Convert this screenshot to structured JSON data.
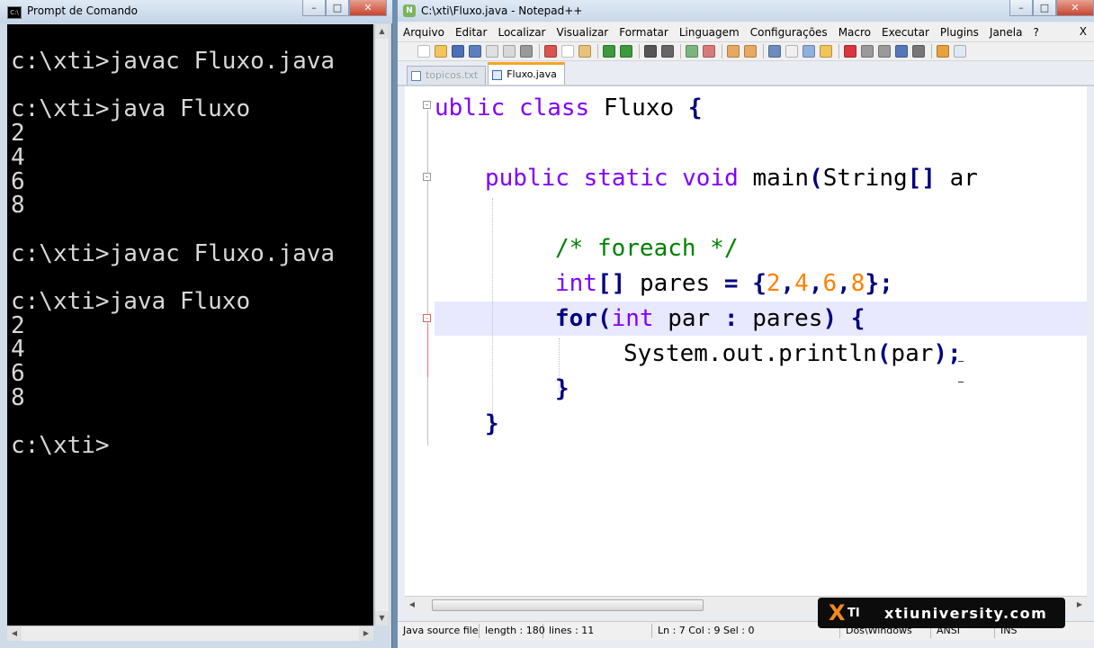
{
  "cmd": {
    "title": "Prompt de Comando",
    "output": "c:\\xti>javac Fluxo.java\n\nc:\\xti>java Fluxo\n2\n4\n6\n8\n\nc:\\xti>javac Fluxo.java\n\nc:\\xti>java Fluxo\n2\n4\n6\n8\n\nc:\\xti>"
  },
  "npp": {
    "title": "C:\\xti\\Fluxo.java - Notepad++",
    "menu": [
      "Arquivo",
      "Editar",
      "Localizar",
      "Visualizar",
      "Formatar",
      "Linguagem",
      "Configurações",
      "Macro",
      "Executar",
      "Plugins",
      "Janela",
      "?"
    ],
    "menu_close": "X",
    "tabs": [
      {
        "label": "topicos.txt",
        "active": false
      },
      {
        "label": "Fluxo.java",
        "active": true
      }
    ],
    "code": {
      "l1": {
        "kw1": "ublic",
        "kw2": "class",
        "name": "Fluxo",
        "brace": "{"
      },
      "l2": {
        "kw1": "public",
        "kw2": "static",
        "kw3": "void",
        "rest": "main",
        "p1": "(",
        "type": "String",
        "arr": "[]",
        "tail": "ar"
      },
      "l3": {
        "comment": "/* foreach */"
      },
      "l4": {
        "type": "int",
        "arr": "[]",
        "name": "pares",
        "eq": "=",
        "ob": "{",
        "n1": "2",
        "c1": ",",
        "n2": "4",
        "c2": ",",
        "n3": "6",
        "c3": ",",
        "n4": "8",
        "cb": "}",
        "semi": ";"
      },
      "l5": {
        "kw": "for",
        "p1": "(",
        "type": "int",
        "var": "par",
        "colon": ":",
        "coll": "pares",
        "p2": ")",
        "brace": "{"
      },
      "l6": {
        "call": "System.out.println",
        "p1": "(",
        "arg": "par",
        "p2": ")",
        "semi": ";"
      },
      "l7": {
        "brace": "}"
      },
      "l8": {
        "brace": "}"
      }
    },
    "status": {
      "type": "Java source file",
      "length": "length : 180",
      "lines": "lines : 11",
      "pos": "Ln : 7    Col : 9    Sel : 0",
      "eol": "Dos\\Windows",
      "enc": "ANSI",
      "mode": "INS"
    },
    "colors": {
      "keyword": "#8000ff",
      "operator": "#000080",
      "number": "#ff8000",
      "comment": "#008000",
      "highlight": "#e8e8ff"
    }
  },
  "badge": {
    "logo": "XTI",
    "logo_x": "X",
    "logo_ti": "TI",
    "text": "xtiuniversity.com"
  }
}
